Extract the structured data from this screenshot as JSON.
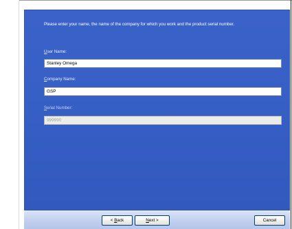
{
  "intro": {
    "text": "Please enter your name, the name of the company for which you work and the product serial number."
  },
  "fields": {
    "user_name": {
      "label": "User Name:",
      "value": "Stanley Omega"
    },
    "company_name": {
      "label": "Company Name:",
      "value": "GSP"
    },
    "serial_number": {
      "label": "Serial Number:",
      "value": "999990"
    }
  },
  "buttons": {
    "back": "< Back",
    "next": "Next >",
    "cancel": "Cancel"
  },
  "colors": {
    "panel": "#3760c6",
    "bottom_bar": "#c3d1ef"
  }
}
